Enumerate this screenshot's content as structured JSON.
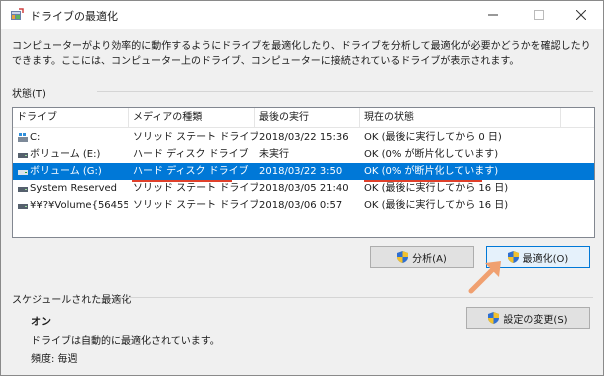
{
  "window": {
    "title": "ドライブの最適化",
    "icon": "defrag-app-icon",
    "controls": [
      "minimize-icon",
      "maximize-icon",
      "close-icon"
    ]
  },
  "description": "コンピューターがより効率的に動作するようにドライブを最適化したり、ドライブを分析して最適化が必要かどうかを確認したりできます。ここには、コンピューター上のドライブ、コンピューターに接続されているドライブが表示されます。",
  "status_section": {
    "label": "状態(T)"
  },
  "drive_list": {
    "columns": [
      "ドライブ",
      "メディアの種類",
      "最後の実行",
      "現在の状態"
    ],
    "rows": [
      {
        "drive": "C:",
        "media": "ソリッド ステート ドライブ",
        "last_run": "2018/03/22 15:36",
        "status": "OK (最後に実行してから 0 日)",
        "icon": "windows-drive-icon",
        "selected": false
      },
      {
        "drive": "ボリューム (E:)",
        "media": "ハード ディスク ドライブ",
        "last_run": "未実行",
        "status": "OK (0% が断片化しています)",
        "icon": "drive-icon",
        "selected": false
      },
      {
        "drive": "ボリューム (G:)",
        "media": "ハード ディスク ドライブ",
        "last_run": "2018/03/22 3:50",
        "status": "OK (0% が断片化しています)",
        "icon": "drive-icon",
        "selected": true
      },
      {
        "drive": "System Reserved",
        "media": "ソリッド ステート ドライブ",
        "last_run": "2018/03/05 21:40",
        "status": "OK (最後に実行してから 16 日)",
        "icon": "drive-icon",
        "selected": false
      },
      {
        "drive": "¥¥?¥Volume{56455...",
        "media": "ソリッド ステート ドライブ",
        "last_run": "2018/03/06 0:57",
        "status": "OK (最後に実行してから 16 日)",
        "icon": "drive-icon",
        "selected": false
      }
    ]
  },
  "buttons": {
    "analyze": "分析(A)",
    "optimize": "最適化(O)",
    "change_settings": "設定の変更(S)"
  },
  "schedule": {
    "label": "スケジュールされた最適化",
    "state": "オン",
    "description": "ドライブは自動的に最適化されています。",
    "frequency": "頻度: 毎週"
  },
  "colors": {
    "selection": "#0078d7",
    "annotation_red": "#e0402a",
    "annotation_arrow": "#f0a070"
  }
}
